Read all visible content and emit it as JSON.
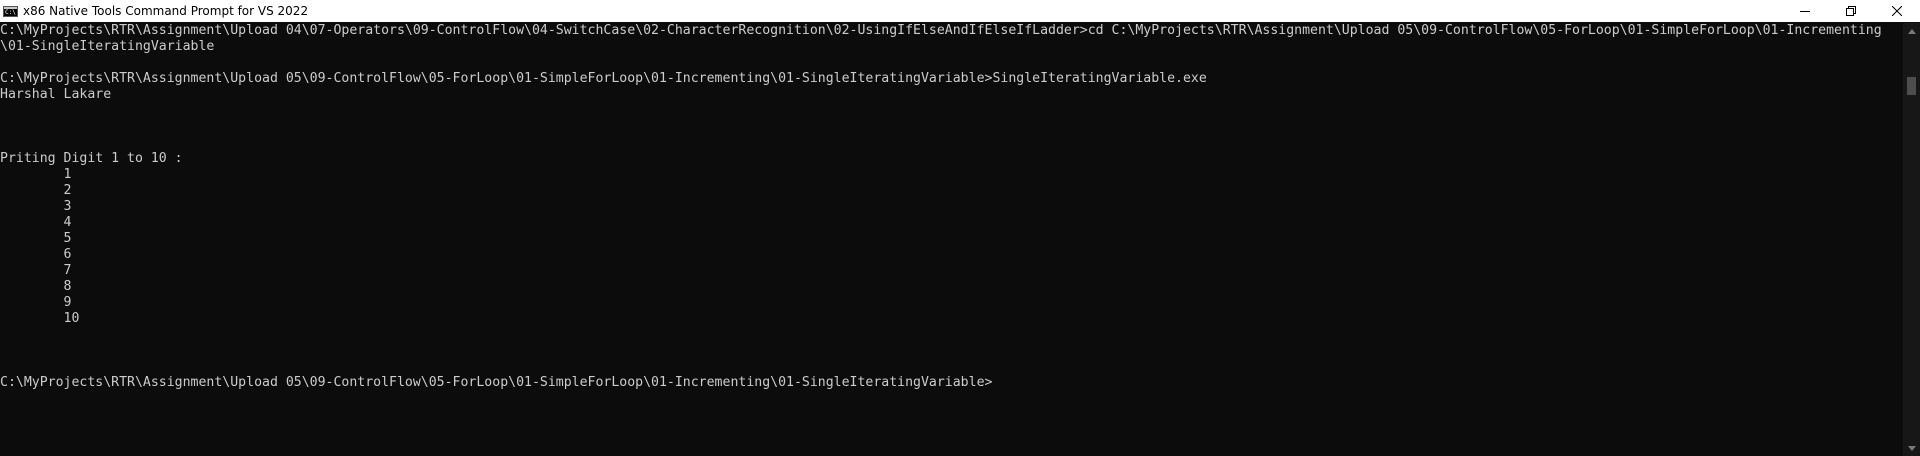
{
  "window": {
    "title": "x86 Native Tools Command Prompt for VS 2022",
    "icon": "console-app-icon",
    "icon_glyph": "C:\\"
  },
  "controls": {
    "minimize": "minimize-icon",
    "restore": "restore-icon",
    "close": "close-icon"
  },
  "console": {
    "lines": [
      "C:\\MyProjects\\RTR\\Assignment\\Upload 04\\07-Operators\\09-ControlFlow\\04-SwitchCase\\02-CharacterRecognition\\02-UsingIfElseAndIfElseIfLadder>cd C:\\MyProjects\\RTR\\Assignment\\Upload 05\\09-ControlFlow\\05-ForLoop\\01-SimpleForLoop\\01-Incrementing",
      "\\01-SingleIteratingVariable",
      "",
      "C:\\MyProjects\\RTR\\Assignment\\Upload 05\\09-ControlFlow\\05-ForLoop\\01-SimpleForLoop\\01-Incrementing\\01-SingleIteratingVariable>SingleIteratingVariable.exe",
      "Harshal Lakare",
      "",
      "",
      "",
      "Priting Digit 1 to 10 :",
      "        1",
      "        2",
      "        3",
      "        4",
      "        5",
      "        6",
      "        7",
      "        8",
      "        9",
      "        10",
      "",
      "",
      "",
      "C:\\MyProjects\\RTR\\Assignment\\Upload 05\\09-ControlFlow\\05-ForLoop\\01-SimpleForLoop\\01-Incrementing\\01-SingleIteratingVariable>"
    ]
  },
  "colors": {
    "background": "#0c0c0c",
    "text": "#cccccc",
    "titlebar": "#ffffff"
  }
}
